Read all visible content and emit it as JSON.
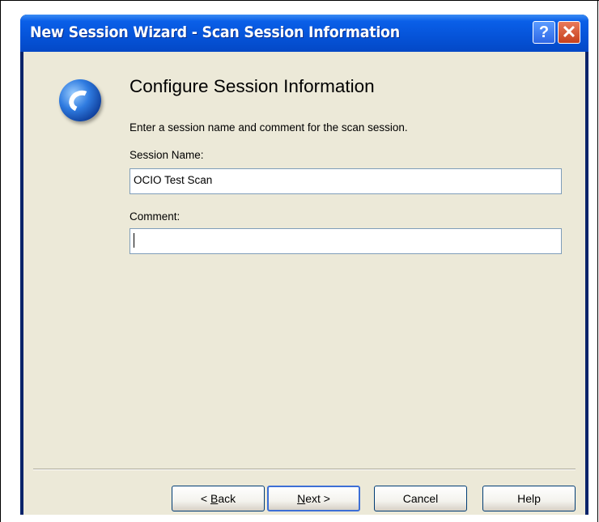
{
  "window": {
    "title": "New Session Wizard - Scan Session Information"
  },
  "titlebar": {
    "help_glyph": "?",
    "close_glyph": "✕"
  },
  "page": {
    "heading": "Configure Session Information",
    "description": "Enter a session name and comment for the scan session."
  },
  "form": {
    "session_name_label": "Session Name:",
    "session_name_value": "OCIO Test Scan",
    "comment_label": "Comment:",
    "comment_value": ""
  },
  "buttons": {
    "back": {
      "prefix": "< ",
      "mnemonic": "B",
      "rest": "ack"
    },
    "next": {
      "mnemonic": "N",
      "rest": "ext >"
    },
    "cancel": "Cancel",
    "help": "Help"
  },
  "icons": {
    "logo": "app-logo-icon",
    "help": "help-icon",
    "close": "close-icon"
  }
}
